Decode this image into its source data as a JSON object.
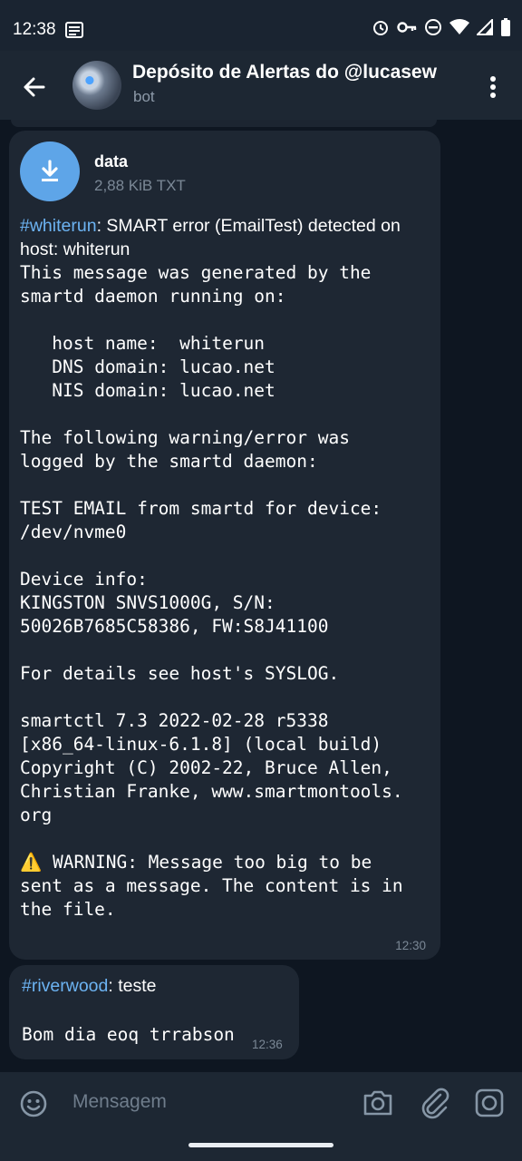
{
  "status_bar": {
    "time": "12:38",
    "icons": [
      "notes-icon",
      "alarm-icon",
      "key-icon",
      "dnd-icon",
      "wifi-icon",
      "signal-icon",
      "battery-icon"
    ]
  },
  "header": {
    "title": "Depósito de Alertas do @lucasew",
    "subtitle": "bot"
  },
  "messages": [
    {
      "file": {
        "name": "data",
        "meta": "2,88 KiB TXT"
      },
      "hashtag": "#whiterun",
      "first_line": ": SMART error (EmailTest) detected on host: whiterun",
      "body": "This message was generated by the\nsmartd daemon running on:\n\n   host name:  whiterun\n   DNS domain: lucao.net\n   NIS domain: lucao.net\n\nThe following warning/error was\nlogged by the smartd daemon:\n\nTEST EMAIL from smartd for device:\n/dev/nvme0\n\nDevice info:\nKINGSTON SNVS1000G, S/N:\n50026B7685C58386, FW:S8J41100\n\nFor details see host's SYSLOG.\n\nsmartctl 7.3 2022-02-28 r5338\n[x86_64-linux-6.1.8] (local build)\nCopyright (C) 2002-22, Bruce Allen,\nChristian Franke, www.smartmontools.\norg\n\n",
      "warning": " WARNING: Message too big to be\nsent as a message. The content is in\nthe file.",
      "time": "12:30"
    },
    {
      "hashtag": "#riverwood",
      "text": ": teste",
      "body": "Bom dia eoq trrabson",
      "time": "12:36"
    }
  ],
  "input": {
    "placeholder": "Mensagem"
  }
}
